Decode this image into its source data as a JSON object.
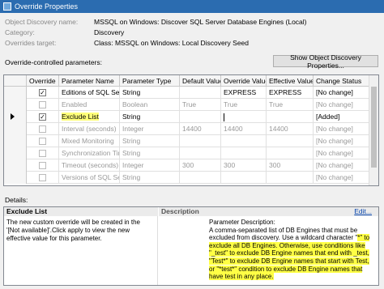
{
  "window": {
    "title": "Override Properties"
  },
  "info": [
    {
      "label": "Object Discovery name:",
      "value": "MSSQL on Windows: Discover SQL Server Database Engines (Local)"
    },
    {
      "label": "Category:",
      "value": "Discovery"
    },
    {
      "label": "Overrides target:",
      "value": "Class: MSSQL on Windows: Local Discovery Seed"
    }
  ],
  "params_label": "Override-controlled parameters:",
  "show_button": "Show Object Discovery Properties...",
  "grid": {
    "headers": [
      "Override",
      "Parameter Name",
      "Parameter Type",
      "Default Value",
      "Override Value",
      "Effective Value",
      "Change Status"
    ],
    "rows": [
      {
        "checked": true,
        "enabled": true,
        "name": "Editions of SQL Ser...",
        "type": "String",
        "default": "",
        "override": "EXPRESS",
        "effective": "EXPRESS",
        "status": "[No change]"
      },
      {
        "checked": false,
        "enabled": false,
        "name": "Enabled",
        "type": "Boolean",
        "default": "True",
        "override": "True",
        "effective": "True",
        "status": "[No change]"
      },
      {
        "checked": true,
        "enabled": true,
        "name": "Exclude List",
        "type": "String",
        "default": "",
        "override": "",
        "effective": "",
        "status": "[Added]",
        "current": true
      },
      {
        "checked": false,
        "enabled": false,
        "name": "Interval (seconds)",
        "type": "Integer",
        "default": "14400",
        "override": "14400",
        "effective": "14400",
        "status": "[No change]"
      },
      {
        "checked": false,
        "enabled": false,
        "name": "Mixed Monitoring",
        "type": "String",
        "default": "",
        "override": "",
        "effective": "",
        "status": "[No change]"
      },
      {
        "checked": false,
        "enabled": false,
        "name": "Synchronization Time",
        "type": "String",
        "default": "",
        "override": "",
        "effective": "",
        "status": "[No change]"
      },
      {
        "checked": false,
        "enabled": false,
        "name": "Timeout (seconds)",
        "type": "Integer",
        "default": "300",
        "override": "300",
        "effective": "300",
        "status": "[No change]"
      },
      {
        "checked": false,
        "enabled": false,
        "name": "Versions of SQL Ser...",
        "type": "String",
        "default": "",
        "override": "",
        "effective": "",
        "status": "[No change]"
      }
    ]
  },
  "details": {
    "label": "Details:",
    "title": "Exclude List",
    "description_header": "Description",
    "edit_link": "Edit...",
    "left_text": "The new custom override will be created in the '[Not available]'.Click apply to view  the new effective value for this parameter.",
    "right_text_plain": "Parameter Description:\nA comma-separated list of DB Engines that must be excluded from discovery. Use a wildcard character \"",
    "right_text_highlight": "*\" to exclude all DB Engines. Otherwise, use conditions like \"_test\" to exclude DB Engine names that end with _test, \"Test*\" to exclude DB Engine names that start with Test, or \"*test*\" condition to exclude DB Engine names that have test in any place."
  },
  "colors": {
    "titlebar": "#2b6cb0",
    "highlight": "#ffff7a",
    "link": "#0645ad"
  }
}
